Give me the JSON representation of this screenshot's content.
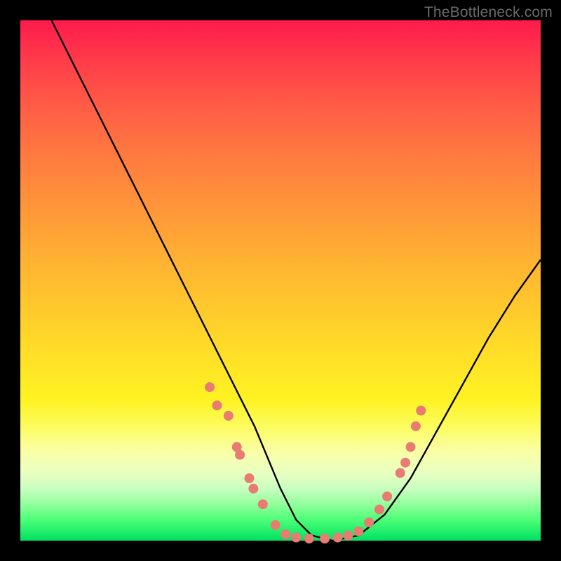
{
  "watermark": "TheBottleneck.com",
  "chart_data": {
    "type": "line",
    "title": "",
    "xlabel": "",
    "ylabel": "",
    "xlim": [
      0,
      100
    ],
    "ylim": [
      0,
      100
    ],
    "series": [
      {
        "name": "bottleneck-curve",
        "x": [
          6,
          10,
          15,
          20,
          25,
          30,
          35,
          40,
          45,
          50,
          53,
          56,
          60,
          65,
          70,
          75,
          80,
          85,
          90,
          95,
          100
        ],
        "y": [
          100,
          92,
          82,
          72,
          62,
          52,
          42,
          32,
          22,
          10,
          4,
          1,
          0,
          1,
          5,
          12,
          21,
          30,
          39,
          47,
          54
        ]
      }
    ],
    "markers": {
      "name": "highlight-dots",
      "color": "#e97b72",
      "points_xy": [
        [
          36.4,
          29.5
        ],
        [
          37.8,
          26.0
        ],
        [
          40.0,
          24.0
        ],
        [
          41.6,
          18.0
        ],
        [
          42.2,
          16.5
        ],
        [
          44.0,
          12.0
        ],
        [
          44.8,
          10.0
        ],
        [
          46.6,
          7.0
        ],
        [
          49.0,
          3.0
        ],
        [
          51.0,
          1.2
        ],
        [
          53.0,
          0.6
        ],
        [
          55.5,
          0.4
        ],
        [
          58.5,
          0.4
        ],
        [
          61.0,
          0.6
        ],
        [
          63.0,
          1.0
        ],
        [
          65.0,
          1.8
        ],
        [
          67.0,
          3.5
        ],
        [
          69.0,
          6.0
        ],
        [
          70.5,
          8.5
        ],
        [
          73.0,
          13.0
        ],
        [
          74.0,
          15.0
        ],
        [
          75.0,
          18.0
        ],
        [
          76.0,
          22.0
        ],
        [
          77.0,
          25.0
        ]
      ]
    }
  }
}
